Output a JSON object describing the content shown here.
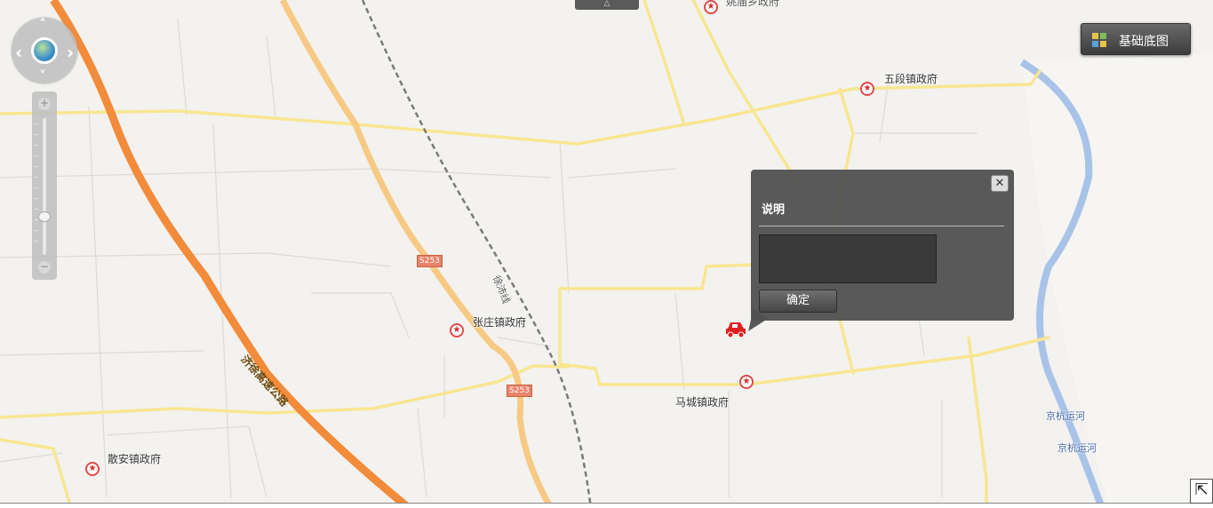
{
  "map": {
    "place_labels": [
      {
        "id": "wuduan",
        "text": "五段镇政府"
      },
      {
        "id": "zhangzhuang",
        "text": "张庄镇政府"
      },
      {
        "id": "macheng",
        "text": "马城镇政府"
      },
      {
        "id": "sanan",
        "text": "散安镇政府"
      },
      {
        "id": "top",
        "text": "姚庙乡政府"
      }
    ],
    "road_labels": {
      "railway": "徐沛线",
      "expressway": "济徐高速公路",
      "shield_1": "S253",
      "shield_2": "S253"
    },
    "river_labels": [
      "京杭运河",
      "京杭运河"
    ],
    "colors": {
      "background": "#f3f2ef",
      "expressway": "#f28b3a",
      "provincial_road": "#f7c983",
      "county_road": "#f8e691",
      "river": "#a9c3e8",
      "railway": "#7a7a7a"
    }
  },
  "controls": {
    "nav_arrows": [
      "‹",
      "›",
      "˄",
      "˅"
    ],
    "zoom_in": "+",
    "zoom_out": "−",
    "zoom_level_fraction": 0.28,
    "basemap_button": "基础底图",
    "top_handle": "△",
    "corner_button": "⇱"
  },
  "dialog": {
    "title": "说明",
    "close": "✕",
    "description_value": "",
    "confirm": "确定"
  },
  "marker": {
    "icon": "car-icon",
    "color": "#e02020"
  }
}
